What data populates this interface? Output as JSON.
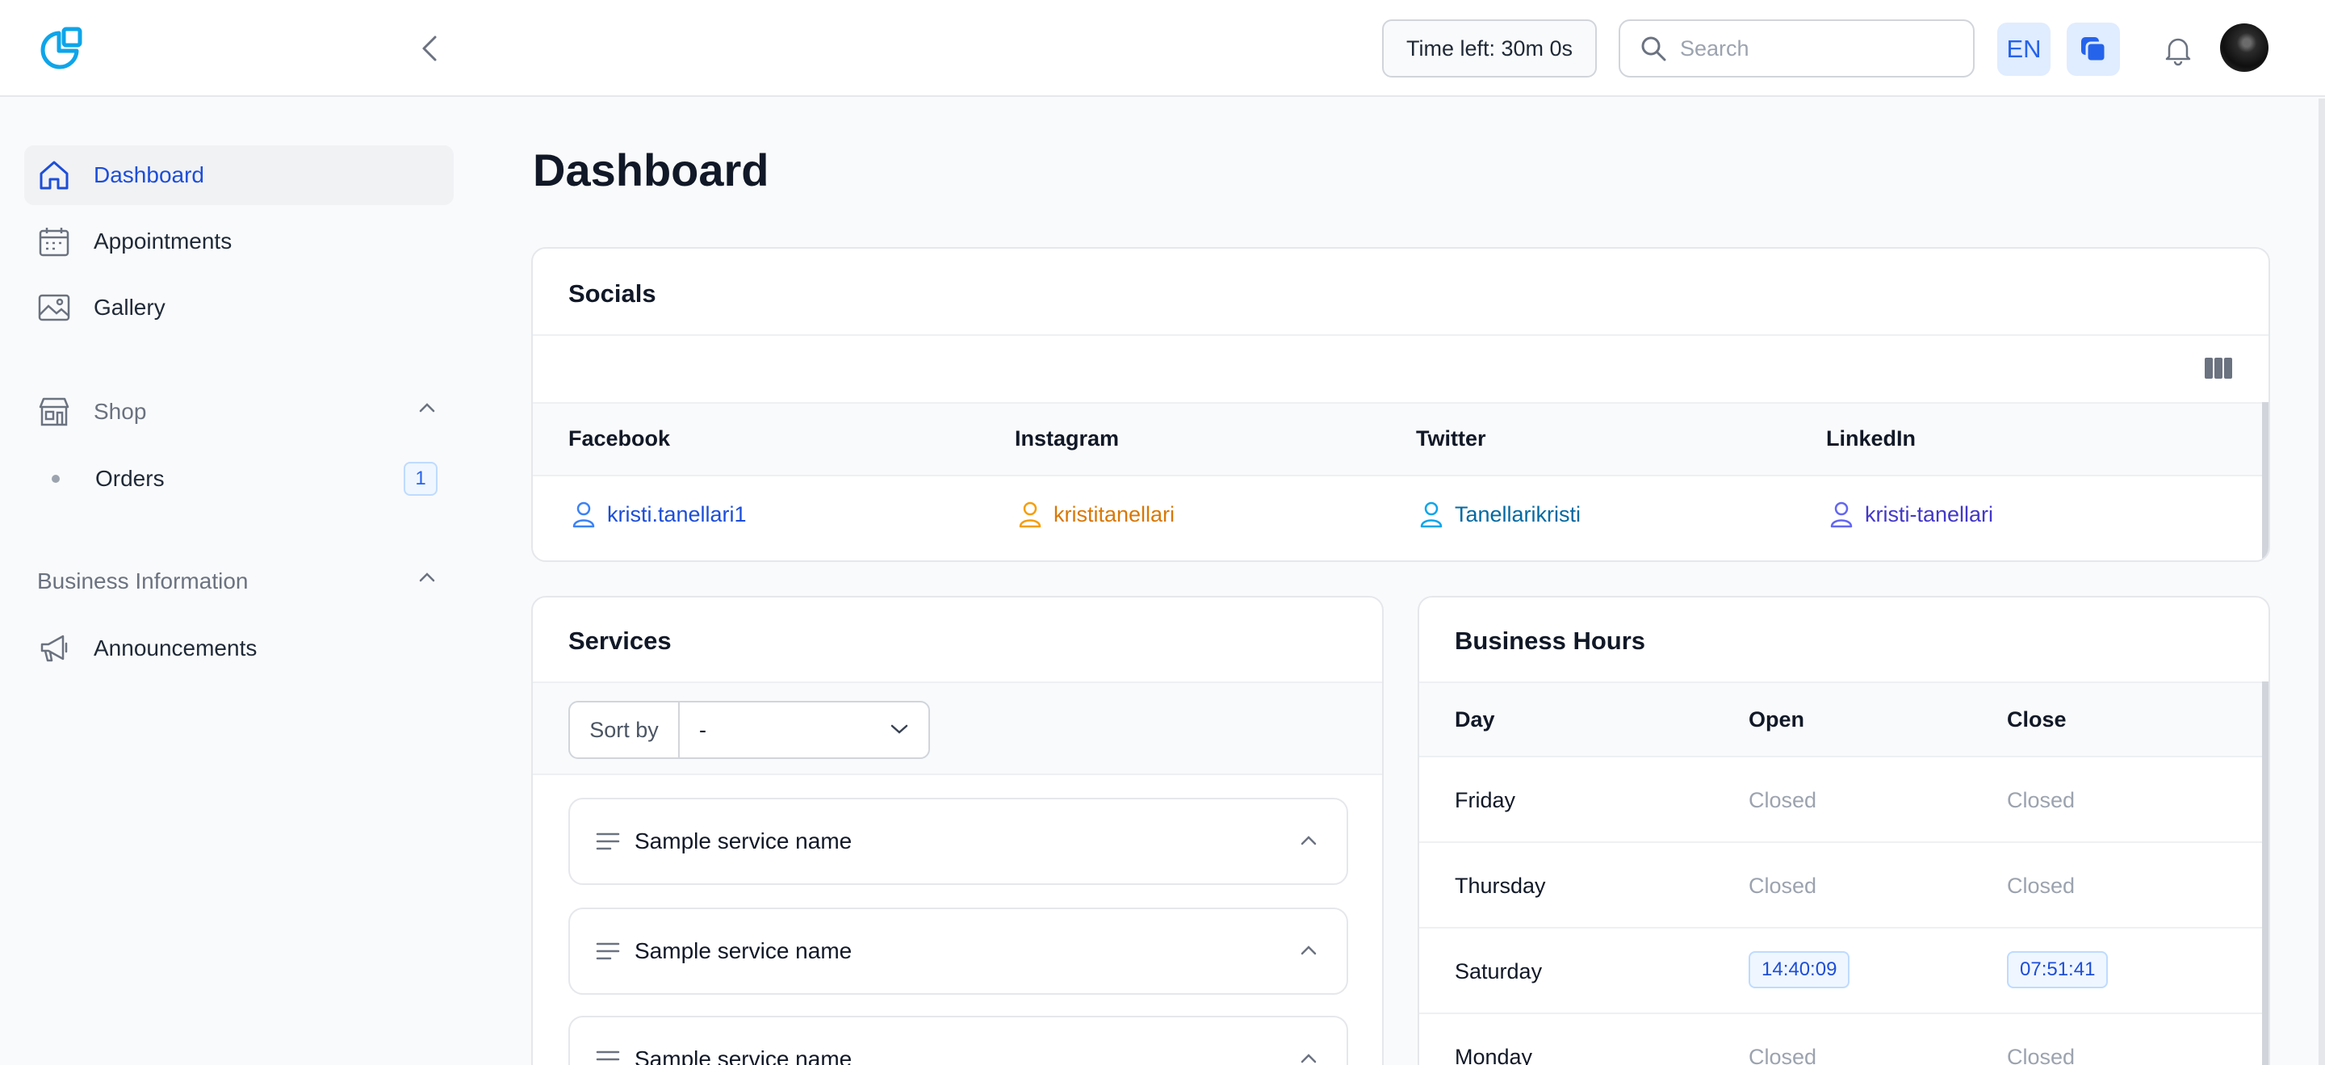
{
  "header": {
    "timer_label": "Time left: 30m 0s",
    "search_placeholder": "Search",
    "language": "EN"
  },
  "sidebar": {
    "items": [
      {
        "label": "Dashboard",
        "icon": "home-icon",
        "active": true
      },
      {
        "label": "Appointments",
        "icon": "calendar-icon"
      },
      {
        "label": "Gallery",
        "icon": "image-icon"
      }
    ],
    "shop": {
      "label": "Shop",
      "icon": "store-icon",
      "children": [
        {
          "label": "Orders",
          "badge": "1"
        }
      ]
    },
    "business_information": {
      "label": "Business Information",
      "children": [
        {
          "label": "Announcements",
          "icon": "megaphone-icon"
        }
      ]
    }
  },
  "main": {
    "title": "Dashboard",
    "socials": {
      "title": "Socials",
      "columns": [
        "Facebook",
        "Instagram",
        "Twitter",
        "LinkedIn"
      ],
      "links": [
        {
          "handle": "kristi.tanellari1",
          "color": "#1d4ed8"
        },
        {
          "handle": "kristitanellari",
          "color": "#d97706"
        },
        {
          "handle": "Tanellarikristi",
          "color": "#0369a1"
        },
        {
          "handle": "kristi-tanellari",
          "color": "#4338ca"
        }
      ]
    },
    "services": {
      "title": "Services",
      "sort_label": "Sort by",
      "sort_value": "-",
      "items": [
        "Sample service name",
        "Sample service name",
        "Sample service name"
      ]
    },
    "business_hours": {
      "title": "Business Hours",
      "columns": [
        "Day",
        "Open",
        "Close"
      ],
      "rows": [
        {
          "day": "Friday",
          "open": "Closed",
          "close": "Closed"
        },
        {
          "day": "Thursday",
          "open": "Closed",
          "close": "Closed"
        },
        {
          "day": "Saturday",
          "open": "14:40:09",
          "close": "07:51:41"
        },
        {
          "day": "Monday",
          "open": "Closed",
          "close": "Closed"
        }
      ]
    }
  }
}
